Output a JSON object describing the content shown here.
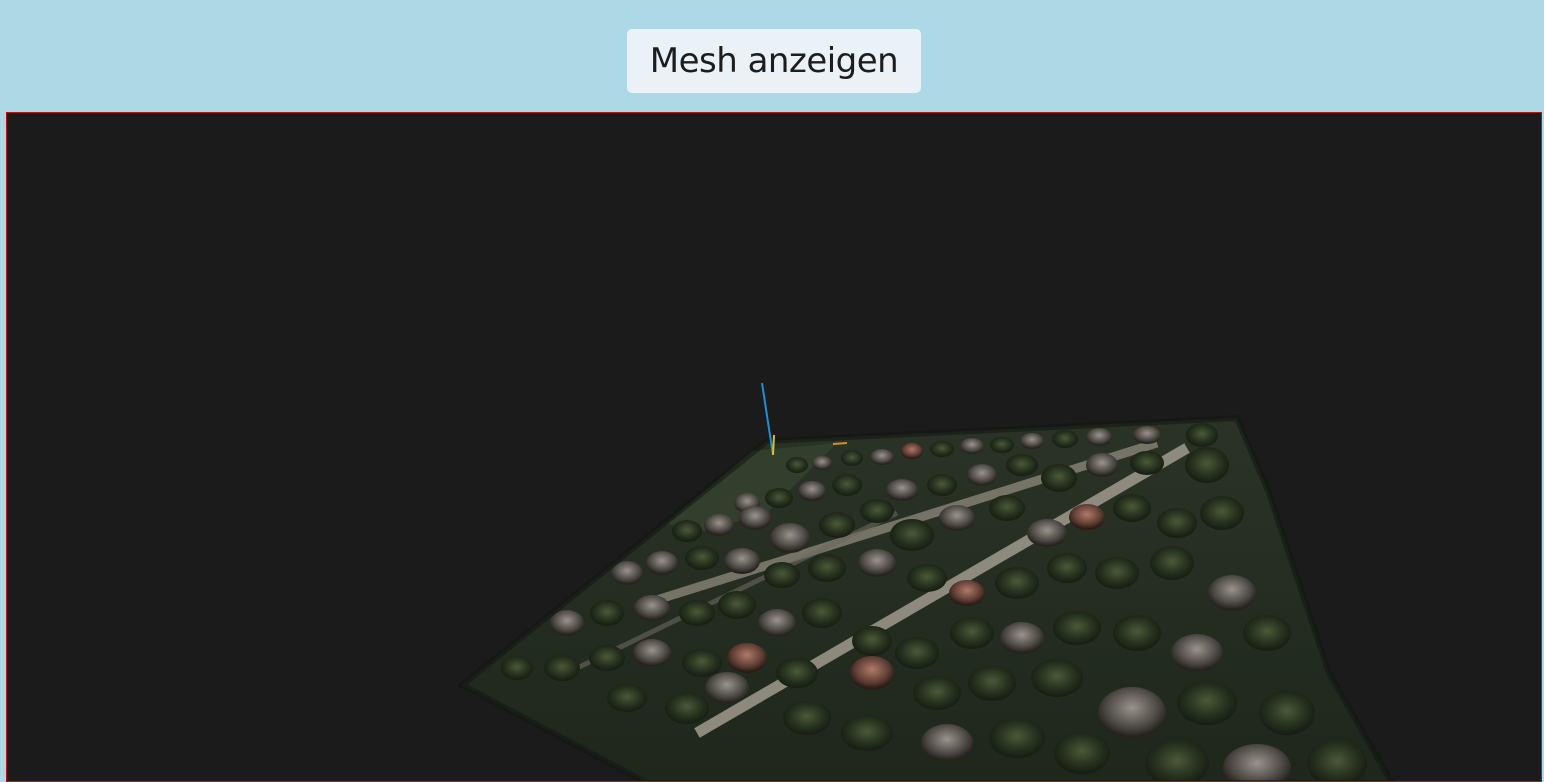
{
  "toolbar": {
    "show_mesh_label": "Mesh anzeigen"
  },
  "viewer": {
    "background_color": "#1b1b1b",
    "border_color": "#b01818",
    "axis_colors": {
      "vertical": "#1e8fd6",
      "secondary": "#d8c020",
      "tertiary": "#d89020"
    }
  },
  "colors": {
    "page_background": "#add8e6",
    "button_background": "#eaf1f7"
  }
}
